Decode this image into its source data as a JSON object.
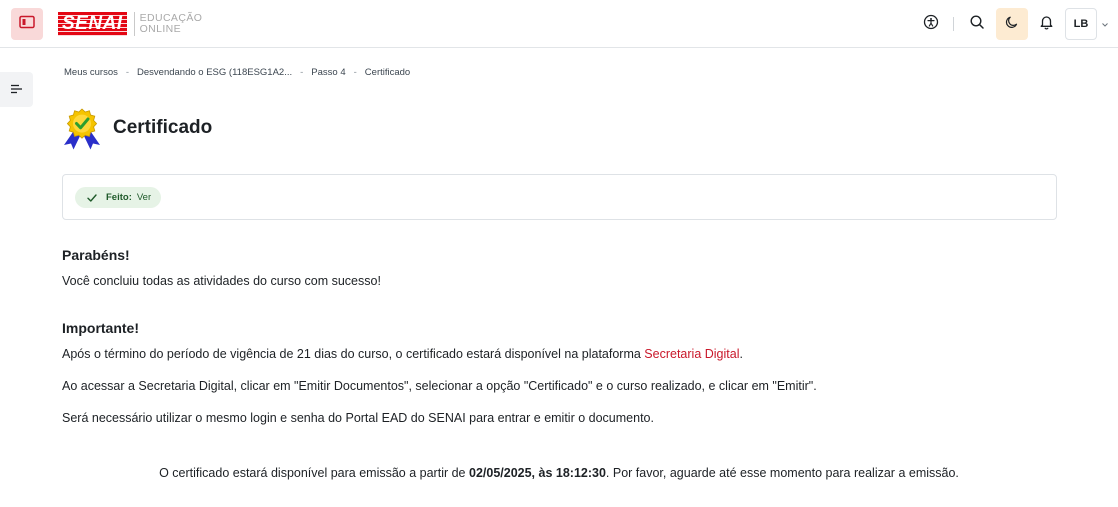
{
  "header": {
    "logo_text": "SENAI",
    "logo_sub_line1": "EDUCAÇÃO",
    "logo_sub_line2": "ONLINE",
    "user_initials": "LB"
  },
  "icons": {
    "drawer_toggle": "sidebar-panel-icon",
    "accessibility": "accessibility-icon",
    "search": "search-icon",
    "dark_mode": "moon-icon",
    "notifications": "bell-icon",
    "user_menu": "chevron-down-icon",
    "course_index": "list-lines-icon",
    "certificate": "award-ribbon-icon"
  },
  "colors": {
    "brand_red": "#e30613",
    "link_red": "#c9182a",
    "done_badge_bg": "#e6f3e6",
    "dark_mode_bg": "#fdebd2"
  },
  "breadcrumb": [
    {
      "label": "Meus cursos"
    },
    {
      "label": "Desvendando o ESG (118ESG1A2..."
    },
    {
      "label": "Passo 4"
    },
    {
      "label": "Certificado"
    }
  ],
  "breadcrumb_separator": "-",
  "page": {
    "title": "Certificado"
  },
  "completion": {
    "status_label": "Feito:",
    "status_value": "Ver"
  },
  "content": {
    "congrats_heading": "Parabéns!",
    "congrats_text": "Você concluiu todas as atividades do curso com sucesso!",
    "important_heading": "Importante!",
    "para1_before": "Após o término do período de vigência de 21 dias do curso, o certificado estará disponível na plataforma ",
    "para1_link": "Secretaria Digital",
    "para1_after": ".",
    "para2": "Ao acessar a Secretaria Digital, clicar em \"Emitir Documentos\", selecionar a opção \"Certificado\" e o curso realizado, e clicar em \"Emitir\".",
    "para3": "Será necessário utilizar o mesmo login e senha do Portal EAD do SENAI para entrar e emitir o documento.",
    "availability_before": "O certificado estará disponível para emissão a partir de ",
    "availability_date": "02/05/2025, às 18:12:30",
    "availability_after": ". Por favor, aguarde até esse momento para realizar a emissão."
  }
}
